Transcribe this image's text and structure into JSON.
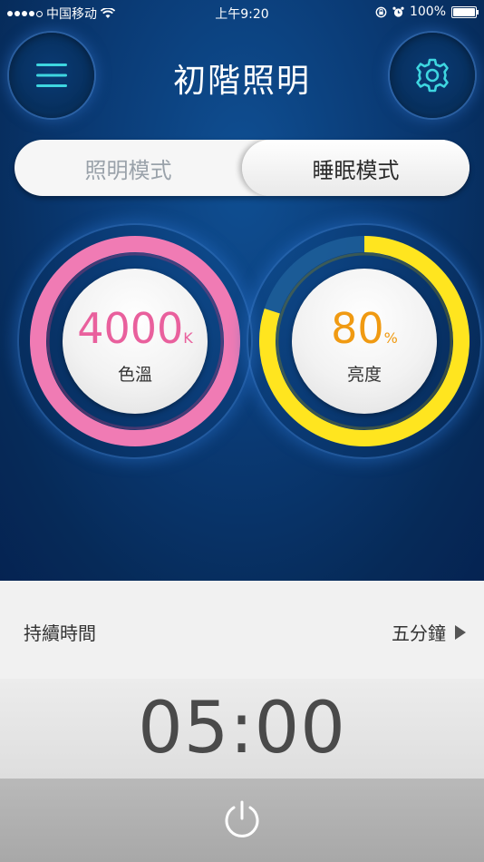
{
  "status_bar": {
    "carrier": "中国移动",
    "time": "上午9:20",
    "battery": "100%"
  },
  "header": {
    "title": "初階照明",
    "menu_icon": "hamburger-menu-icon",
    "settings_icon": "gear-icon"
  },
  "mode_switch": {
    "options": [
      "照明模式",
      "睡眠模式"
    ],
    "selected": "睡眠模式"
  },
  "dials": {
    "color_temp": {
      "value": "4000",
      "unit": "K",
      "label": "色溫",
      "color": "#e9609d",
      "ring_color": "#f07bb4"
    },
    "brightness": {
      "value": "80",
      "unit": "%",
      "label": "亮度",
      "color": "#f09a12",
      "ring_color": "#ffe51f",
      "level_percent": 80
    }
  },
  "duration": {
    "label": "持續時間",
    "value": "五分鐘"
  },
  "timer": {
    "display": "05:00"
  },
  "power": {
    "icon": "power-icon"
  },
  "colors": {
    "header_bg": "#0a3a74",
    "accent_cyan": "#3ed6e0"
  }
}
